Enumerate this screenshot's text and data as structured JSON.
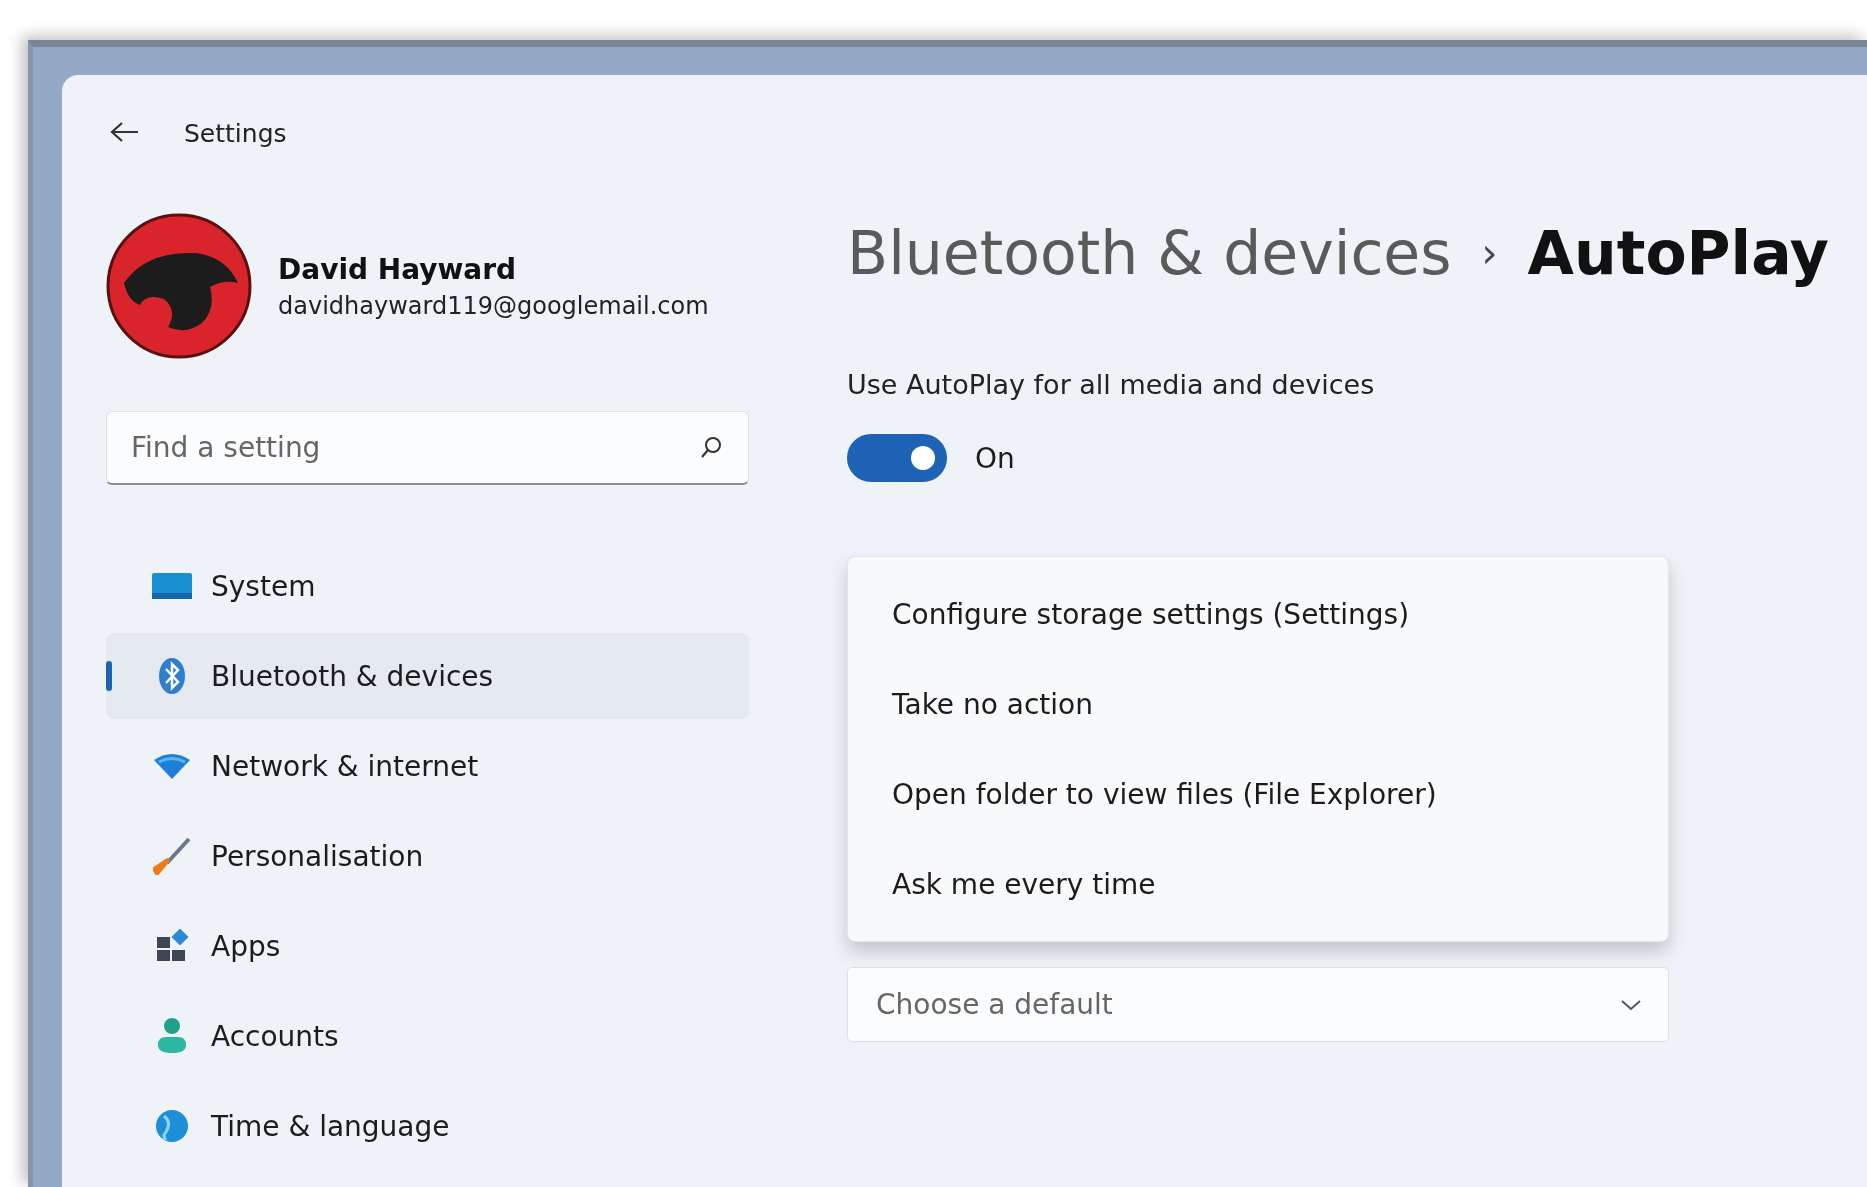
{
  "window": {
    "title": "Settings"
  },
  "profile": {
    "name": "David Hayward",
    "email": "davidhayward119@googlemail.com"
  },
  "search": {
    "placeholder": "Find a setting"
  },
  "nav": [
    {
      "label": "System",
      "selected": false
    },
    {
      "label": "Bluetooth & devices",
      "selected": true
    },
    {
      "label": "Network & internet",
      "selected": false
    },
    {
      "label": "Personalisation",
      "selected": false
    },
    {
      "label": "Apps",
      "selected": false
    },
    {
      "label": "Accounts",
      "selected": false
    },
    {
      "label": "Time & language",
      "selected": false
    }
  ],
  "breadcrumb": {
    "parent": "Bluetooth & devices",
    "separator": "›",
    "current": "AutoPlay"
  },
  "autoplay_toggle": {
    "label": "Use AutoPlay for all media and devices",
    "on": true,
    "state_text": "On"
  },
  "menu": {
    "items": [
      "Configure storage settings (Settings)",
      "Take no action",
      "Open folder to view files (File Explorer)",
      "Ask me every time"
    ]
  },
  "dropdown": {
    "placeholder": "Choose a default"
  }
}
